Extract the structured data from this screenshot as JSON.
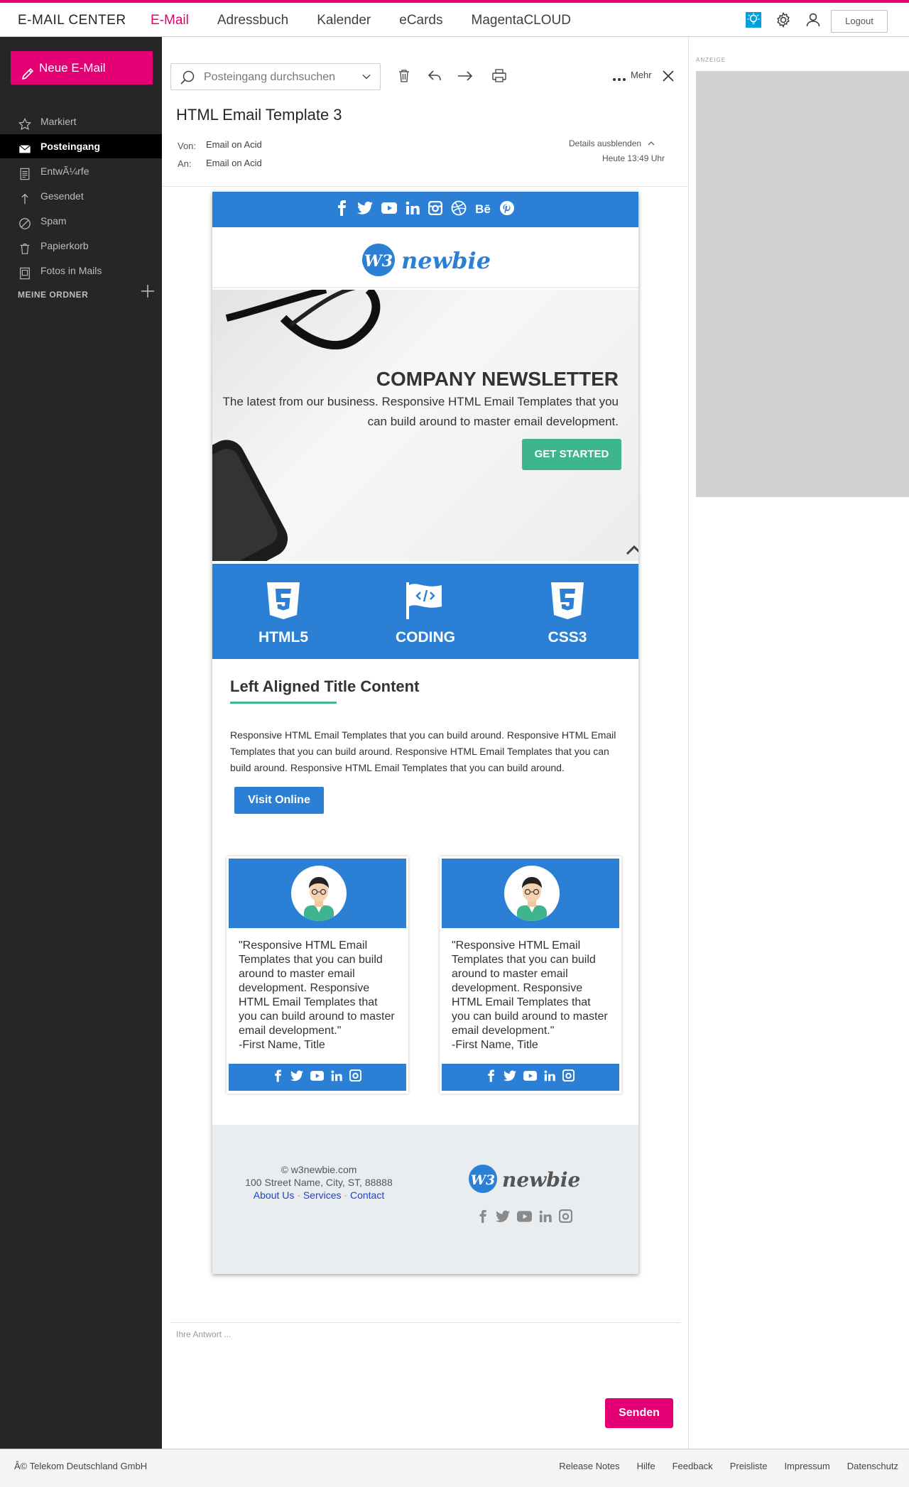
{
  "app": {
    "brand": "E-MAIL CENTER",
    "nav": [
      "E-Mail",
      "Adressbuch",
      "Kalender",
      "eCards",
      "MagentaCLOUD"
    ],
    "logout_label": "Logout",
    "accent_color": "#e20074"
  },
  "sidebar": {
    "new_mail_label": "Neue E-Mail",
    "items": [
      {
        "label": "Markiert",
        "icon": "star-icon"
      },
      {
        "label": "Posteingang",
        "icon": "envelope-icon",
        "active": true
      },
      {
        "label": "EntwÃ¼rfe",
        "icon": "draft-icon"
      },
      {
        "label": "Gesendet",
        "icon": "send-icon"
      },
      {
        "label": "Spam",
        "icon": "spam-icon"
      },
      {
        "label": "Papierkorb",
        "icon": "trash-icon"
      },
      {
        "label": "Fotos in Mails",
        "icon": "photo-icon"
      }
    ],
    "folders_label": "MEINE ORDNER"
  },
  "message": {
    "search_placeholder": "Posteingang durchsuchen",
    "more_label": "Mehr",
    "subject": "HTML Email Template 3",
    "from_label": "Von:",
    "from_value": "Email on Acid",
    "to_label": "An:",
    "to_value": "Email on Acid",
    "details_toggle": "Details ausblenden",
    "time": "Heute 13:49 Uhr",
    "reply_placeholder": "Ihre Antwort ...",
    "send_label": "Senden"
  },
  "newsletter": {
    "logo_text": "newbie",
    "logo_mark": "W3",
    "hero": {
      "title": "COMPANY NEWSLETTER",
      "text": "The latest from our business. Responsive HTML Email Templates that you can build around to master email development.",
      "button": "GET STARTED"
    },
    "features": [
      "HTML5",
      "CODING",
      "CSS3"
    ],
    "section": {
      "title": "Left Aligned Title Content",
      "body": "Responsive HTML Email Templates that you can build around. Responsive HTML Email Templates that you can build around. Responsive HTML Email Templates that you can build around. Responsive HTML Email Templates that you can build around.",
      "button": "Visit Online"
    },
    "testimonials": [
      {
        "quote": "\"Responsive HTML Email Templates that you can build around to master email development. Responsive HTML Email Templates that you can build around to master email development.\"",
        "author": "-First Name, Title"
      },
      {
        "quote": "\"Responsive HTML Email Templates that you can build around to master email development. Responsive HTML Email Templates that you can build around to master email development.\"",
        "author": "-First Name, Title"
      }
    ],
    "footer": {
      "copyright": "© w3newbie.com",
      "address": "100 Street Name, City, ST, 88888",
      "links": [
        "About Us",
        "Services",
        "Contact"
      ],
      "link_separator": "·"
    },
    "brand_blue": "#2b80d6",
    "brand_green": "#3fb58f"
  },
  "ad": {
    "label": "ANZEIGE"
  },
  "footer": {
    "copyright": "Â© Telekom Deutschland GmbH",
    "links": [
      "Release Notes",
      "Hilfe",
      "Feedback",
      "Preisliste",
      "Impressum",
      "Datenschutz"
    ]
  }
}
